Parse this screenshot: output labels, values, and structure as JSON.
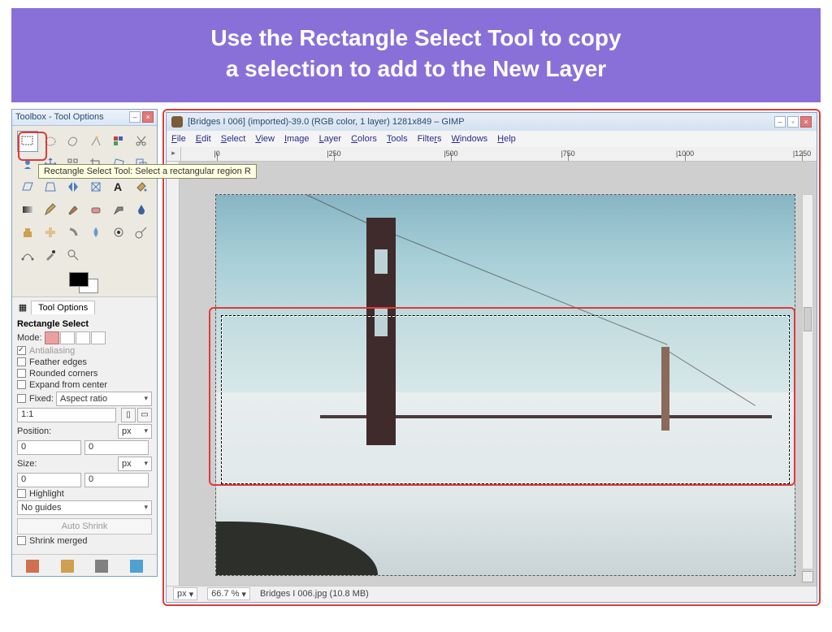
{
  "slide": {
    "headline_l1": "Use the Rectangle Select Tool to copy",
    "headline_l2": "a selection to add to the New Layer"
  },
  "toolbox": {
    "title": "Toolbox - Tool Options",
    "tooltip": "Rectangle Select Tool: Select a rectangular region  R",
    "options_tab": "Tool Options",
    "section_title": "Rectangle Select",
    "mode_label": "Mode:",
    "antialiasing": "Antialiasing",
    "feather": "Feather edges",
    "rounded": "Rounded corners",
    "expand": "Expand from center",
    "fixed": "Fixed:",
    "fixed_value": "Aspect ratio",
    "ratio": "1:1",
    "position_label": "Position:",
    "position_unit": "px",
    "pos_x": "0",
    "pos_y": "0",
    "size_label": "Size:",
    "size_unit": "px",
    "size_w": "0",
    "size_h": "0",
    "highlight": "Highlight",
    "guides": "No guides",
    "auto_shrink": "Auto Shrink",
    "shrink_merged": "Shrink merged"
  },
  "gimp": {
    "title": "[Bridges I 006] (imported)-39.0 (RGB color, 1 layer) 1281x849 – GIMP",
    "menus": [
      "File",
      "Edit",
      "Select",
      "View",
      "Image",
      "Layer",
      "Colors",
      "Tools",
      "Filters",
      "Windows",
      "Help"
    ],
    "ruler_marks": [
      "0",
      "250",
      "500",
      "750",
      "1000",
      "1250"
    ],
    "status_unit": "px",
    "zoom": "66.7 %",
    "filename": "Bridges I 006.jpg (10.8 MB)"
  }
}
